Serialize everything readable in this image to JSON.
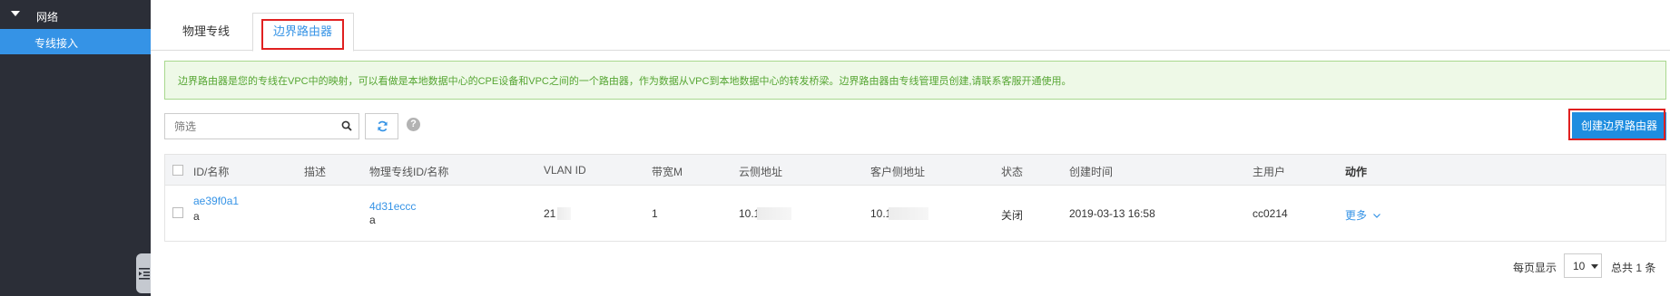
{
  "sidebar": {
    "group_label": "网络",
    "active_item_label": "专线接入"
  },
  "tabs": [
    {
      "label": "物理专线",
      "active": false
    },
    {
      "label": "边界路由器",
      "active": true
    }
  ],
  "notice": "边界路由器是您的专线在VPC中的映射，可以看做是本地数据中心的CPE设备和VPC之间的一个路由器，作为数据从VPC到本地数据中心的转发桥梁。边界路由器由专线管理员创建,请联系客服开通使用。",
  "toolbar": {
    "filter_placeholder": "筛选",
    "help_glyph": "?",
    "create_label": "创建边界路由器"
  },
  "table": {
    "columns": [
      "ID/名称",
      "描述",
      "物理专线ID/名称",
      "VLAN ID",
      "带宽M",
      "云侧地址",
      "客户侧地址",
      "状态",
      "创建时间",
      "主用户",
      "动作"
    ],
    "rows": [
      {
        "id": "ae39f0a1",
        "name": "a",
        "description": "",
        "line_id": "4d31eccc",
        "line_name": "a",
        "vlan_id": "21",
        "bandwidth": "1",
        "cloud_addr": "10.1",
        "customer_addr": "10.1",
        "status": "关闭",
        "created": "2019-03-13 16:58",
        "owner": "cc0214",
        "action": "更多"
      }
    ]
  },
  "pagination": {
    "per_page_label": "每页显示",
    "per_page_value": "10",
    "total_label": "总共 1 条"
  },
  "colors": {
    "sidebar_bg": "#2b2e37",
    "accent": "#3593e6",
    "highlight_border": "#e02020",
    "notice_bg": "#eef9e7",
    "notice_text": "#55a532"
  }
}
